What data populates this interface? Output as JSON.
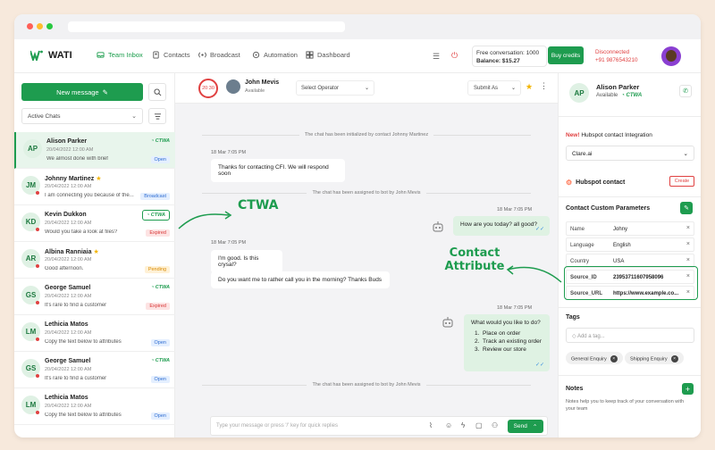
{
  "nav": {
    "brand": "WATI",
    "items": [
      {
        "label": "Team Inbox"
      },
      {
        "label": "Contacts"
      },
      {
        "label": "Broadcast"
      },
      {
        "label": "Automation"
      },
      {
        "label": "Dashboard"
      }
    ],
    "free_conversation": "Free conversation: 1000",
    "balance": "Balance: $15.27",
    "buy_credits": "Buy credits",
    "status": "Disconnected",
    "phone": "+91 9876543210"
  },
  "left": {
    "new_message": "New message",
    "filter": "Active Chats",
    "chats": [
      {
        "initials": "AP",
        "name": "Alison Parker",
        "star": false,
        "ts": "20/04/2022 12:00 AM",
        "preview": "We almost done with brief",
        "ctwa": "CTWA",
        "badge": "Open",
        "selected": true
      },
      {
        "initials": "JM",
        "name": "Johnny Martinez",
        "star": true,
        "ts": "20/04/2022 12:00 AM",
        "preview": "I am connecting you because of the...",
        "ctwa": "",
        "badge": "Broadcast"
      },
      {
        "initials": "KD",
        "name": "Kevin Dukkon",
        "star": false,
        "ts": "20/04/2022 12:00 AM",
        "preview": "Would you take a look at files?",
        "ctwa": "CTWA",
        "badge": "Expired"
      },
      {
        "initials": "AR",
        "name": "Albina Ranniaia",
        "star": true,
        "ts": "20/04/2022 12:00 AM",
        "preview": "Good afternoon.",
        "ctwa": "",
        "badge": "Pending"
      },
      {
        "initials": "GS",
        "name": "George Samuel",
        "star": false,
        "ts": "20/04/2022 12:00 AM",
        "preview": "It's rare to find a customer",
        "ctwa": "CTWA",
        "badge": "Expired"
      },
      {
        "initials": "LM",
        "name": "Lethicia Matos",
        "star": false,
        "ts": "20/04/2022 12:00 AM",
        "preview": "Copy the text below to attributes",
        "ctwa": "",
        "badge": "Open"
      },
      {
        "initials": "GS",
        "name": "George Samuel",
        "star": false,
        "ts": "20/04/2022 12:00 AM",
        "preview": "It's rare to find a customer",
        "ctwa": "CTWA",
        "badge": "Open"
      },
      {
        "initials": "LM",
        "name": "Lethicia Matos",
        "star": false,
        "ts": "20/04/2022 12:00 AM",
        "preview": "Copy the text below to attributes",
        "ctwa": "",
        "badge": "Open"
      }
    ]
  },
  "chat": {
    "timer": "20:30",
    "agent_name": "John Mevis",
    "agent_status": "Available",
    "select_operator": "Select Operator",
    "submit_as": "Submit As",
    "sys1": "The chat has been initialized by contact Johnny Martinez",
    "ts1": "18 Mar  7:05 PM",
    "msg1": "Thanks for contacting CFI. We will respond soon",
    "sys2": "The chat has been assigned to bot by John Mevis",
    "ts2": "18 Mar  7:05 PM",
    "msg2": "How are you today? all good?",
    "ts3": "18 Mar  7:05 PM",
    "msg3": "I'm good. Is this crysal?",
    "msg4": "Do you want me to rather call you in the morning? Thanks Buds",
    "ts4": "18 Mar  7:05 PM",
    "msg5_title": "What would you like to do?",
    "msg5_items": [
      "Place on order",
      "Track an existing order",
      "Review our store"
    ],
    "sys3": "The chat has been assigned to bot by John Mevis",
    "composer_placeholder": "Type your message or press '/' key for quick replies",
    "send": "Send"
  },
  "annotations": {
    "ctwa": "CTWA",
    "contact_attr_1": "Contact",
    "contact_attr_2": "Attribute"
  },
  "right": {
    "initials": "AP",
    "name": "Alison Parker",
    "status": "Available",
    "ctwa": "CTWA",
    "hub_new": "New!",
    "hub_label": "Hubspot contact Integration",
    "selected_account": "Clare.ai",
    "hubspot_contact": "Hubspot contact",
    "create": "Create",
    "ccp_title": "Contact Custom Parameters",
    "params": [
      {
        "k": "Name",
        "v": "Johny"
      },
      {
        "k": "Language",
        "v": "English"
      },
      {
        "k": "Country",
        "v": "USA"
      },
      {
        "k": "Source_ID",
        "v": "23953711607958096"
      },
      {
        "k": "Source_URL",
        "v": "https://www.example.co..."
      }
    ],
    "tags_title": "Tags",
    "add_tag": "Add a tag...",
    "tags": [
      "General Enquiry",
      "Shipping Enquiry"
    ],
    "notes_title": "Notes",
    "notes_desc": "Notes help you to keep track of your conversation with your team"
  },
  "colors": {
    "accent": "#1e9c4f",
    "danger": "#e04141",
    "bg": "#f7e9dc"
  }
}
